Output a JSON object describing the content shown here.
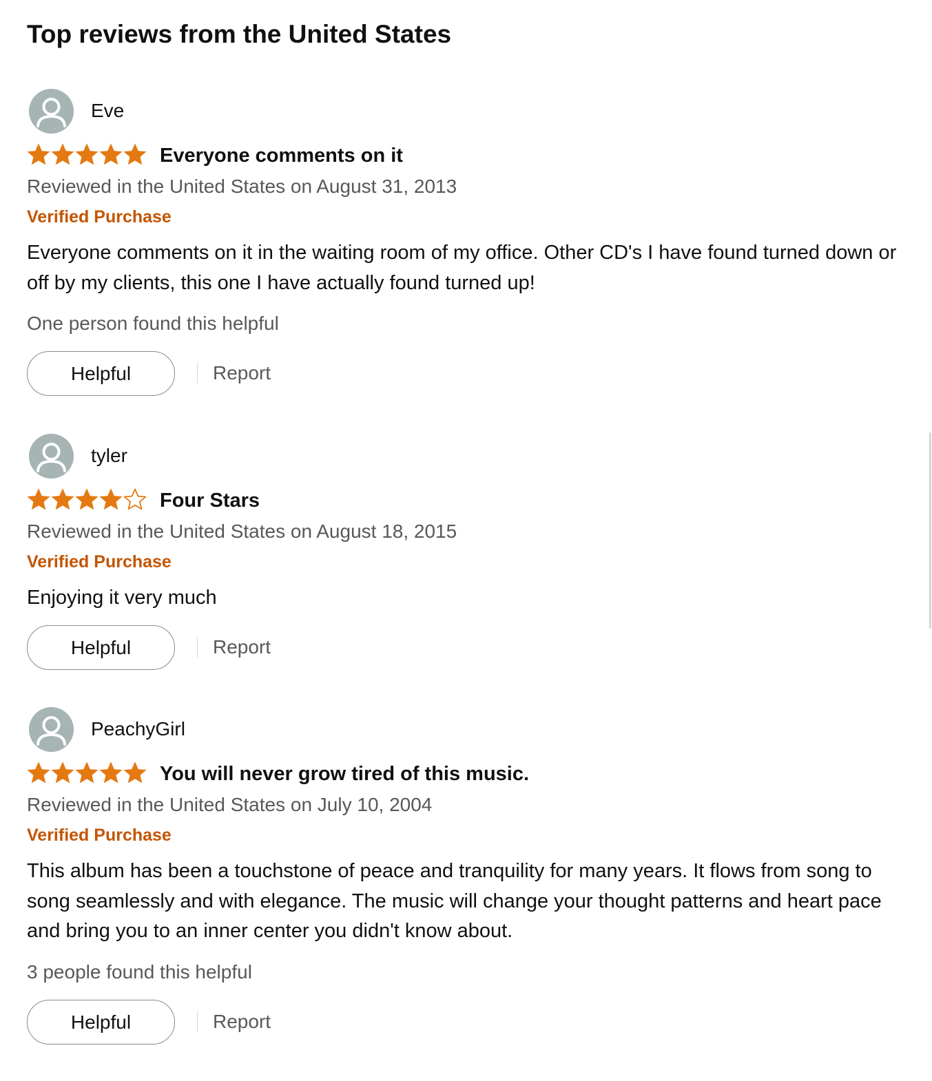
{
  "section_title": "Top reviews from the United States",
  "colors": {
    "star": "#e47911",
    "verified": "#c45500",
    "muted_text": "#565959",
    "avatar": "#a6b4b4"
  },
  "reviews": [
    {
      "author": "Eve",
      "rating": 5,
      "rating_max": 5,
      "title": "Everyone comments on it",
      "date": "Reviewed in the United States on August 31, 2013",
      "verified": "Verified Purchase",
      "body": "Everyone comments on it in the waiting room of my office. Other CD's I have found turned down or off by my clients, this one I have actually found turned up!",
      "helpful_count": "One person found this helpful",
      "helpful_label": "Helpful",
      "report_label": "Report"
    },
    {
      "author": "tyler",
      "rating": 4,
      "rating_max": 5,
      "title": "Four Stars",
      "date": "Reviewed in the United States on August 18, 2015",
      "verified": "Verified Purchase",
      "body": "Enjoying it very much",
      "helpful_count": "",
      "helpful_label": "Helpful",
      "report_label": "Report"
    },
    {
      "author": "PeachyGirl",
      "rating": 5,
      "rating_max": 5,
      "title": "You will never grow tired of this music.",
      "date": "Reviewed in the United States on July 10, 2004",
      "verified": "Verified Purchase",
      "body": "This album has been a touchstone of peace and tranquility for many years. It flows from song to song seamlessly and with elegance. The music will change your thought patterns and heart pace and bring you to an inner center you didn't know about.",
      "helpful_count": "3 people found this helpful",
      "helpful_label": "Helpful",
      "report_label": "Report"
    }
  ]
}
